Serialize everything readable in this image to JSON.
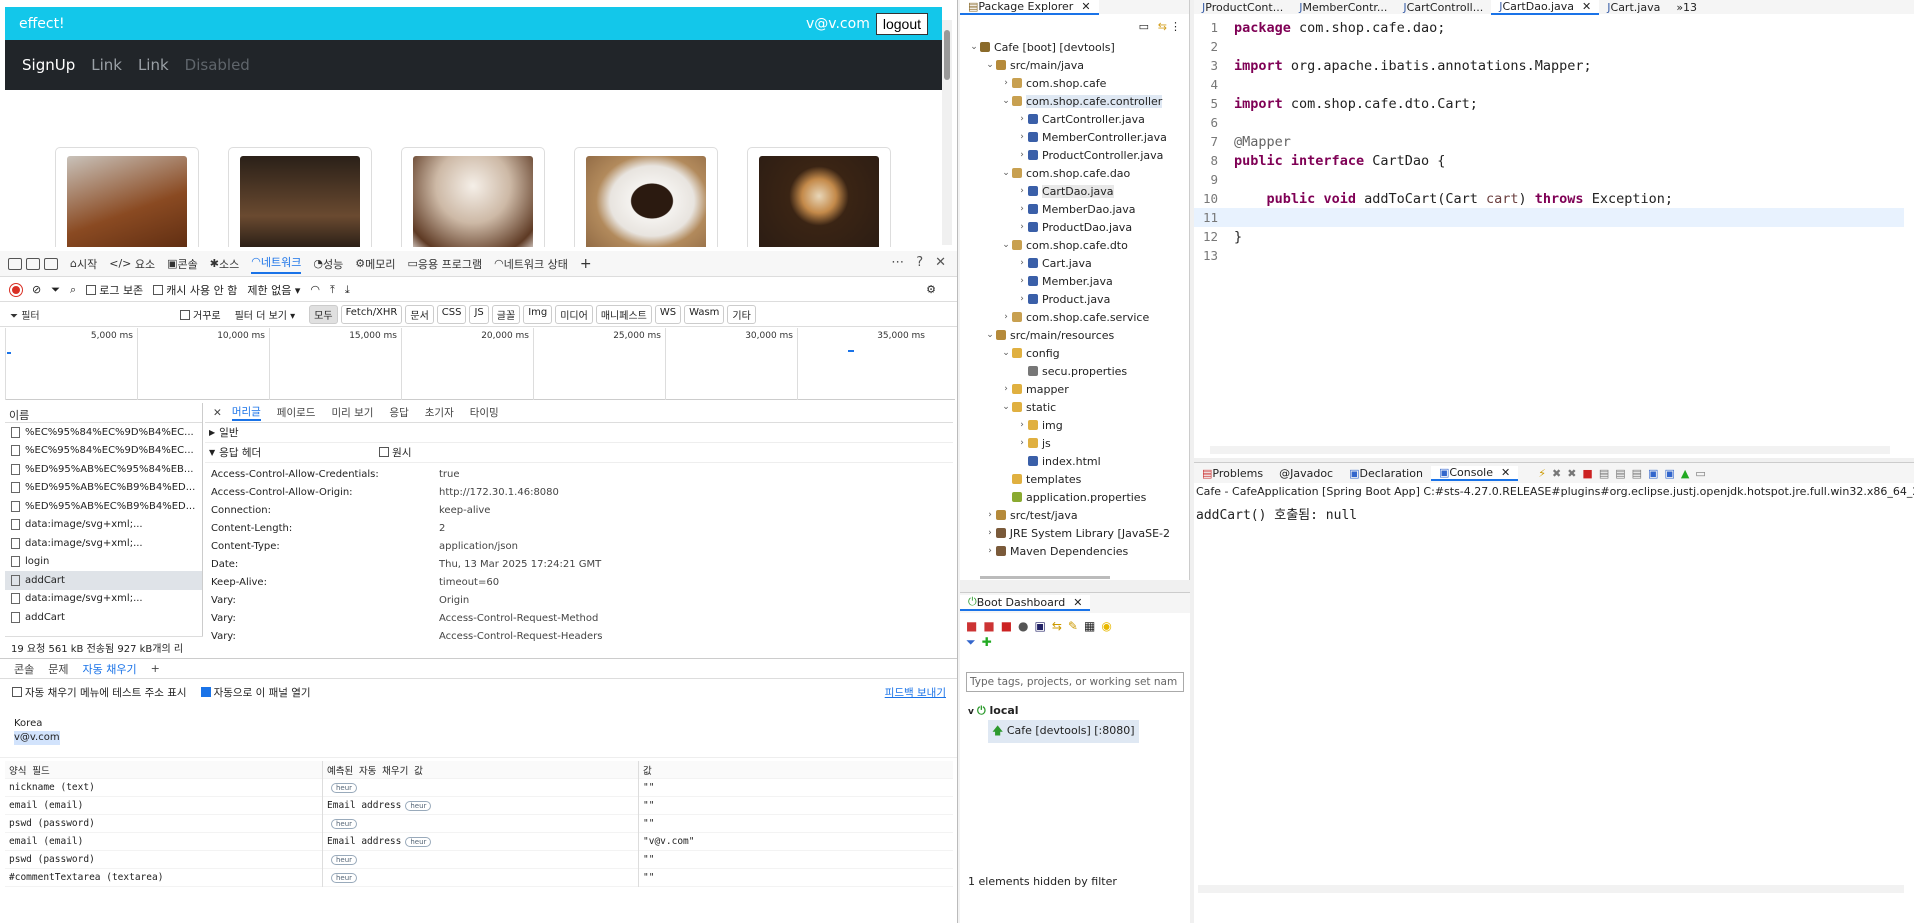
{
  "site": {
    "brand": "effect!",
    "user_email": "v@v.com",
    "logout_label": "logout",
    "nav": [
      "SignUp",
      "Link",
      "Link",
      "Disabled"
    ],
    "products": [
      "iced-coffee",
      "dark-dessert",
      "frappe",
      "espresso-cup",
      "latte-art"
    ]
  },
  "devtools": {
    "tabs": [
      "시작",
      "요소",
      "콘솔",
      "소스",
      "네트워크",
      "성능",
      "메모리",
      "응용 프로그램",
      "네트워크 상태"
    ],
    "active_tab": "네트워크",
    "toolbar": {
      "preserve_log": "로그 보존",
      "disable_cache": "캐시 사용 안 함",
      "throttle": "제한 없음"
    },
    "filter": {
      "placeholder": "필터",
      "invert": "거꾸로",
      "more": "필터 더 보기"
    },
    "type_chips": [
      "모두",
      "Fetch/XHR",
      "문서",
      "CSS",
      "JS",
      "글꼴",
      "Img",
      "미디어",
      "매니페스트",
      "WS",
      "Wasm",
      "기타"
    ],
    "timeline_ticks": [
      "5,000 ms",
      "10,000 ms",
      "15,000 ms",
      "20,000 ms",
      "25,000 ms",
      "30,000 ms",
      "35,000 ms"
    ],
    "requests_header": "이름",
    "requests": [
      {
        "name": "%EC%95%84%EC%9D%B4%EC...",
        "selected": false
      },
      {
        "name": "%EC%95%84%EC%9D%B4%EC...",
        "selected": false
      },
      {
        "name": "%ED%95%AB%EC%95%84%EB...",
        "selected": false
      },
      {
        "name": "%ED%95%AB%EC%B9%B4%ED...",
        "selected": false
      },
      {
        "name": "%ED%95%AB%EC%B9%B4%ED...",
        "selected": false
      },
      {
        "name": "data:image/svg+xml;...",
        "selected": false
      },
      {
        "name": "data:image/svg+xml;...",
        "selected": false
      },
      {
        "name": "login",
        "selected": false
      },
      {
        "name": "addCart",
        "selected": true
      },
      {
        "name": "data:image/svg+xml;...",
        "selected": false
      },
      {
        "name": "addCart",
        "selected": false
      }
    ],
    "summary": "19 요청   561 kB 전송됨   927 kB개의 리",
    "detail_tabs": [
      "머리글",
      "페이로드",
      "미리 보기",
      "응답",
      "초기자",
      "타이밍"
    ],
    "section_general": "일반",
    "section_response": "응답 헤더",
    "raw_label": "원시",
    "headers": [
      {
        "k": "Access-Control-Allow-Credentials:",
        "v": "true"
      },
      {
        "k": "Access-Control-Allow-Origin:",
        "v": "http://172.30.1.46:8080"
      },
      {
        "k": "Connection:",
        "v": "keep-alive"
      },
      {
        "k": "Content-Length:",
        "v": "2"
      },
      {
        "k": "Content-Type:",
        "v": "application/json"
      },
      {
        "k": "Date:",
        "v": "Thu, 13 Mar 2025 17:24:21 GMT"
      },
      {
        "k": "Keep-Alive:",
        "v": "timeout=60"
      },
      {
        "k": "Vary:",
        "v": "Origin"
      },
      {
        "k": "Vary:",
        "v": "Access-Control-Request-Method"
      },
      {
        "k": "Vary:",
        "v": "Access-Control-Request-Headers"
      }
    ]
  },
  "drawer": {
    "tabs": [
      "콘솔",
      "문제",
      "자동 채우기"
    ],
    "active": "자동 채우기",
    "opt1": "자동 채우기 메뉴에 테스트 주소 표시",
    "opt2": "자동으로 이 패널 열기",
    "feedback": "피드백 보내기",
    "address_country": "Korea",
    "address_email": "v@v.com",
    "cols": [
      "양식 필드",
      "예측된 자동 채우기 값",
      "값"
    ],
    "rows": [
      {
        "field": "nickname (text)",
        "pred": "",
        "val": "\"\""
      },
      {
        "field": "email (email)",
        "pred": "Email address",
        "val": "\"\""
      },
      {
        "field": "pswd (password)",
        "pred": "",
        "val": "\"\""
      },
      {
        "field": "email (email)",
        "pred": "Email address",
        "val": "\"v@v.com\""
      },
      {
        "field": "pswd (password)",
        "pred": "",
        "val": "\"\""
      },
      {
        "field": "#commentTextarea (textarea)",
        "pred": "",
        "val": "\"\""
      }
    ],
    "hint": "heur"
  },
  "eclipse": {
    "pkg_title": "Package Explorer",
    "tree": [
      {
        "d": 0,
        "t": "Cafe [boot] [devtools]",
        "ic": "proj",
        "ar": "v"
      },
      {
        "d": 1,
        "t": "src/main/java",
        "ic": "src",
        "ar": "v"
      },
      {
        "d": 2,
        "t": "com.shop.cafe",
        "ic": "pkg",
        "ar": ">"
      },
      {
        "d": 2,
        "t": "com.shop.cafe.controller",
        "ic": "pkg",
        "ar": "v",
        "sel": true
      },
      {
        "d": 3,
        "t": "CartController.java",
        "ic": "java",
        "ar": ">"
      },
      {
        "d": 3,
        "t": "MemberController.java",
        "ic": "java",
        "ar": ">"
      },
      {
        "d": 3,
        "t": "ProductController.java",
        "ic": "java",
        "ar": ">"
      },
      {
        "d": 2,
        "t": "com.shop.cafe.dao",
        "ic": "pkg",
        "ar": "v"
      },
      {
        "d": 3,
        "t": "CartDao.java",
        "ic": "java",
        "ar": ">",
        "sel2": true
      },
      {
        "d": 3,
        "t": "MemberDao.java",
        "ic": "java",
        "ar": ">"
      },
      {
        "d": 3,
        "t": "ProductDao.java",
        "ic": "java",
        "ar": ">"
      },
      {
        "d": 2,
        "t": "com.shop.cafe.dto",
        "ic": "pkg",
        "ar": "v"
      },
      {
        "d": 3,
        "t": "Cart.java",
        "ic": "java",
        "ar": ">"
      },
      {
        "d": 3,
        "t": "Member.java",
        "ic": "java",
        "ar": ">"
      },
      {
        "d": 3,
        "t": "Product.java",
        "ic": "java",
        "ar": ">"
      },
      {
        "d": 2,
        "t": "com.shop.cafe.service",
        "ic": "pkg",
        "ar": ">"
      },
      {
        "d": 1,
        "t": "src/main/resources",
        "ic": "src",
        "ar": "v"
      },
      {
        "d": 2,
        "t": "config",
        "ic": "folder",
        "ar": "v"
      },
      {
        "d": 3,
        "t": "secu.properties",
        "ic": "file",
        "ar": ""
      },
      {
        "d": 2,
        "t": "mapper",
        "ic": "folder",
        "ar": ">"
      },
      {
        "d": 2,
        "t": "static",
        "ic": "folder",
        "ar": "v"
      },
      {
        "d": 3,
        "t": "img",
        "ic": "folder",
        "ar": ">"
      },
      {
        "d": 3,
        "t": "js",
        "ic": "folder",
        "ar": ">"
      },
      {
        "d": 3,
        "t": "index.html",
        "ic": "html",
        "ar": ""
      },
      {
        "d": 2,
        "t": "templates",
        "ic": "folder",
        "ar": ""
      },
      {
        "d": 2,
        "t": "application.properties",
        "ic": "props",
        "ar": ""
      },
      {
        "d": 1,
        "t": "src/test/java",
        "ic": "src",
        "ar": ">"
      },
      {
        "d": 1,
        "t": "JRE System Library [JavaSE-2",
        "ic": "lib",
        "ar": ">"
      },
      {
        "d": 1,
        "t": "Maven Dependencies",
        "ic": "lib",
        "ar": ">"
      }
    ],
    "editor_tabs": [
      {
        "t": "ProductCont...",
        "on": false
      },
      {
        "t": "MemberContr...",
        "on": false
      },
      {
        "t": "CartControll...",
        "on": false
      },
      {
        "t": "CartDao.java",
        "on": true
      },
      {
        "t": "Cart.java",
        "on": false
      }
    ],
    "tab_overflow": "»13",
    "code": [
      "package com.shop.cafe.dao;",
      "",
      "import org.apache.ibatis.annotations.Mapper;",
      "",
      "import com.shop.cafe.dto.Cart;",
      "",
      "@Mapper",
      "public interface CartDao {",
      "",
      "    public void addToCart(Cart cart) throws Exception;",
      "",
      "}",
      ""
    ],
    "current_line": 11,
    "console_tabs": [
      "Problems",
      "Javadoc",
      "Declaration",
      "Console"
    ],
    "console_launch": "Cafe - CafeApplication [Spring Boot App] C:#sts-4.27.0.RELEASE#plugins#org.eclipse.justj.openjdk.hotspot.jre.full.win32.x86_64_21.0",
    "console_output": "addCart() 호출됨: null",
    "boot_title": "Boot Dashboard",
    "boot_filter_placeholder": "Type tags, projects, or working set nam",
    "boot_local": "local",
    "boot_app": "Cafe [devtools] [:8080]",
    "boot_hidden": "1 elements hidden by filter"
  }
}
